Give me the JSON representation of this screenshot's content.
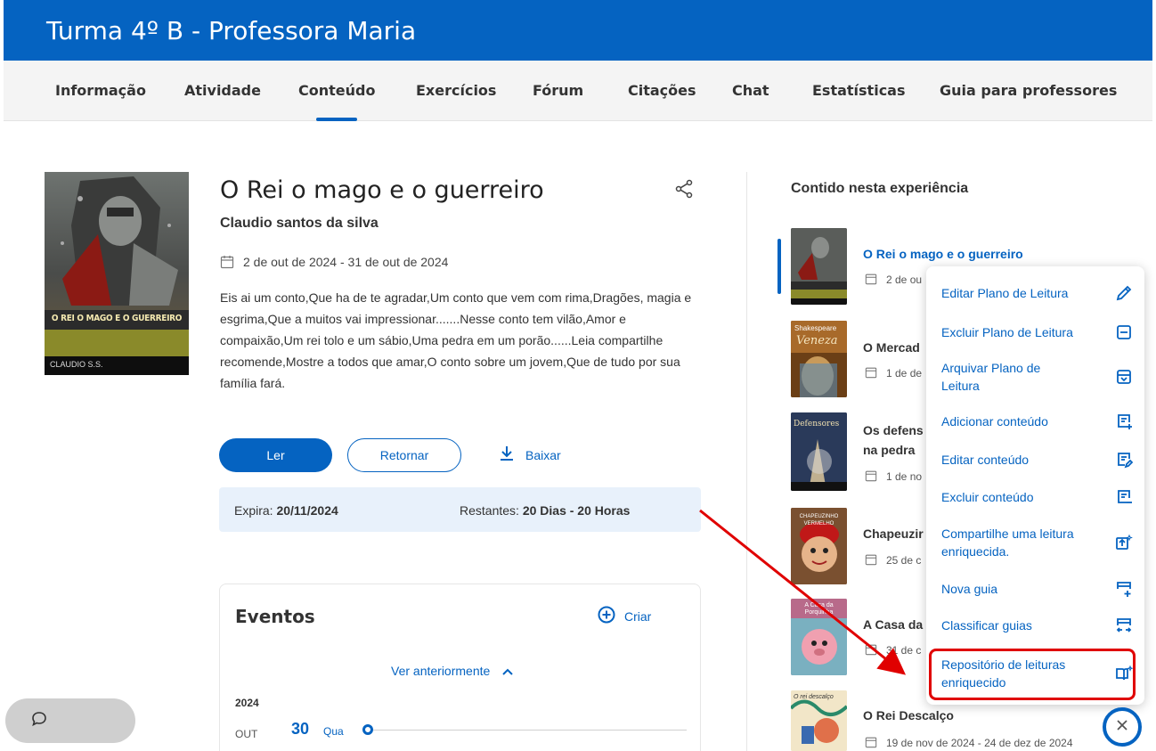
{
  "header": {
    "title": "Turma 4º B - Professora Maria"
  },
  "tabs": [
    {
      "label": "Informação"
    },
    {
      "label": "Atividade"
    },
    {
      "label": "Conteúdo"
    },
    {
      "label": "Exercícios"
    },
    {
      "label": "Fórum"
    },
    {
      "label": "Citações"
    },
    {
      "label": "Chat"
    },
    {
      "label": "Estatísticas"
    },
    {
      "label": "Guia para professores"
    }
  ],
  "active_tab": "Conteúdo",
  "book": {
    "cover_text": "O REI O MAGO E O GUERREIRO",
    "cover_author": "CLAUDIO S.S.",
    "title": "O Rei o mago e o guerreiro",
    "author": "Claudio santos da silva",
    "date_range": "2 de out de 2024 - 31 de out de 2024",
    "description": "Eis ai um conto,Que ha de te agradar,Um conto que vem com rima,Dragões, magia e esgrima,Que a muitos vai impressionar.......Nesse conto tem vilão,Amor e compaixão,Um rei tolo e um sábio,Uma pedra em um porão......Leia compartilhe recomende,Mostre a todos que amar,O conto sobre um jovem,Que de tudo por sua família fará."
  },
  "actions": {
    "read": "Ler",
    "return": "Retornar",
    "download": "Baixar"
  },
  "expiry": {
    "expires_label": "Expira: ",
    "expires_value": "20/11/2024",
    "remaining_label": "Restantes: ",
    "remaining_value": "20 Dias - 20 Horas"
  },
  "events": {
    "title": "Eventos",
    "create": "Criar",
    "see_previous": "Ver anteriormente",
    "year": "2024",
    "month": "OUT",
    "day": "30",
    "weekday": "Qua"
  },
  "sidebar": {
    "title": "Contido nesta experiência",
    "items": [
      {
        "title": "O Rei o mago e o guerreiro",
        "date": "2 de ou"
      },
      {
        "title": "O Mercad",
        "date": "1 de de"
      },
      {
        "title": "Os defens",
        "title2": "na pedra",
        "date": "1 de no"
      },
      {
        "title": "Chapeuzir",
        "date": "25 de c"
      },
      {
        "title": "A Casa da",
        "date": "31 de c"
      },
      {
        "title": "O Rei Descalço",
        "date": "19 de nov de 2024 - 24 de dez de 2024"
      }
    ],
    "cover_texts": [
      "Shakespeare",
      "Veneza",
      "Defensores",
      "CHAPEUZINHO VERMELHO",
      "A Casa da Porquinha",
      "O rei descalço"
    ]
  },
  "menu": {
    "items": [
      {
        "label": "Editar Plano de Leitura",
        "icon": "pencil-icon"
      },
      {
        "label": "Excluir Plano de Leitura",
        "icon": "minus-square-icon"
      },
      {
        "label": "Arquivar Plano de Leitura",
        "icon": "archive-icon"
      },
      {
        "label": "Adicionar conteúdo",
        "icon": "doc-add-icon"
      },
      {
        "label": "Editar conteúdo",
        "icon": "doc-edit-icon"
      },
      {
        "label": "Excluir conteúdo",
        "icon": "doc-remove-icon"
      },
      {
        "label": "Compartilhe uma leitura enriquecida.",
        "icon": "share-sparkle-icon"
      },
      {
        "label": "Nova guia",
        "icon": "new-guide-icon"
      },
      {
        "label": "Classificar guias",
        "icon": "sort-guides-icon"
      },
      {
        "label": "Repositório de leituras enriquecido",
        "icon": "book-sparkle-icon"
      }
    ]
  },
  "colors": {
    "primary": "#0563c1",
    "highlight": "#e00000",
    "expiry_bg": "#e8f1fb"
  }
}
